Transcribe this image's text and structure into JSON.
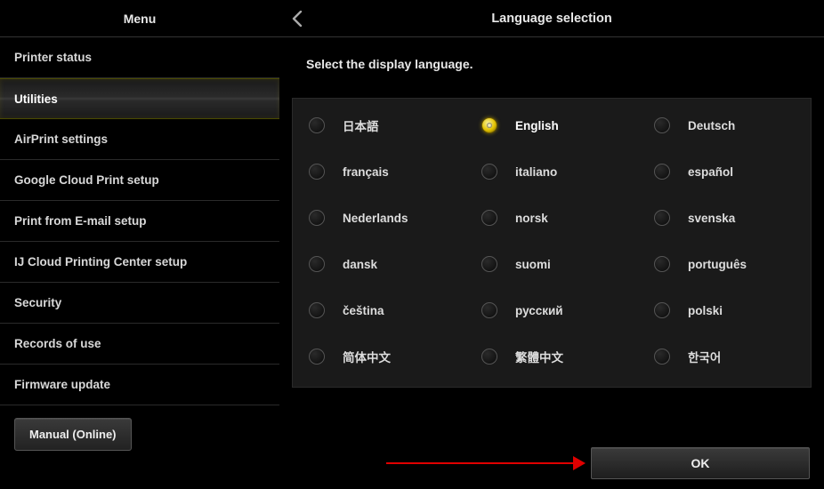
{
  "sidebar": {
    "title": "Menu",
    "items": [
      {
        "label": "Printer status",
        "active": false
      },
      {
        "label": "Utilities",
        "active": true
      },
      {
        "label": "AirPrint settings",
        "active": false
      },
      {
        "label": "Google Cloud Print setup",
        "active": false
      },
      {
        "label": "Print from E-mail setup",
        "active": false
      },
      {
        "label": "IJ Cloud Printing Center setup",
        "active": false
      },
      {
        "label": "Security",
        "active": false
      },
      {
        "label": "Records of use",
        "active": false
      },
      {
        "label": "Firmware update",
        "active": false
      }
    ],
    "manual_label": "Manual (Online)"
  },
  "main": {
    "title": "Language selection",
    "instruction": "Select the display language.",
    "languages": [
      {
        "label": "日本語",
        "selected": false
      },
      {
        "label": "English",
        "selected": true
      },
      {
        "label": "Deutsch",
        "selected": false
      },
      {
        "label": "français",
        "selected": false
      },
      {
        "label": "italiano",
        "selected": false
      },
      {
        "label": "español",
        "selected": false
      },
      {
        "label": "Nederlands",
        "selected": false
      },
      {
        "label": "norsk",
        "selected": false
      },
      {
        "label": "svenska",
        "selected": false
      },
      {
        "label": "dansk",
        "selected": false
      },
      {
        "label": "suomi",
        "selected": false
      },
      {
        "label": "português",
        "selected": false
      },
      {
        "label": "čeština",
        "selected": false
      },
      {
        "label": "русский",
        "selected": false
      },
      {
        "label": "polski",
        "selected": false
      },
      {
        "label": "简体中文",
        "selected": false
      },
      {
        "label": "繁體中文",
        "selected": false
      },
      {
        "label": "한국어",
        "selected": false
      }
    ],
    "ok_label": "OK"
  }
}
